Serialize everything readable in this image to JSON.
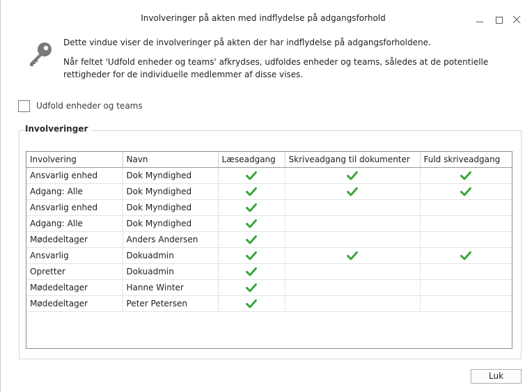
{
  "window": {
    "title": "Involveringer på akten med indflydelse på adgangsforhold"
  },
  "description": {
    "line1": "Dette vindue viser de involveringer på akten der har indflydelse på adgangsforholdene.",
    "line2": "Når feltet 'Udfold enheder og teams' afkrydses, udfoldes enheder og teams, således at de potentielle rettigheder for de individuelle medlemmer af disse vises."
  },
  "expand": {
    "label": "Udfold enheder og teams",
    "checked": false
  },
  "group": {
    "title": "Involveringer"
  },
  "table": {
    "headers": [
      "Involvering",
      "Navn",
      "Læseadgang",
      "Skriveadgang til dokumenter",
      "Fuld skriveadgang"
    ],
    "rows": [
      {
        "involvering": "Ansvarlig enhed",
        "navn": "Dok Myndighed",
        "read": true,
        "write_docs": true,
        "full_write": true
      },
      {
        "involvering": "Adgang: Alle",
        "navn": "Dok Myndighed",
        "read": true,
        "write_docs": true,
        "full_write": true
      },
      {
        "involvering": "Ansvarlig enhed",
        "navn": "Dok Myndighed",
        "read": true,
        "write_docs": false,
        "full_write": false
      },
      {
        "involvering": "Adgang: Alle",
        "navn": "Dok Myndighed",
        "read": true,
        "write_docs": false,
        "full_write": false
      },
      {
        "involvering": "Mødedeltager",
        "navn": "Anders Andersen",
        "read": true,
        "write_docs": false,
        "full_write": false
      },
      {
        "involvering": "Ansvarlig",
        "navn": "Dokuadmin",
        "read": true,
        "write_docs": true,
        "full_write": true
      },
      {
        "involvering": "Opretter",
        "navn": "Dokuadmin",
        "read": true,
        "write_docs": false,
        "full_write": false
      },
      {
        "involvering": "Mødedeltager",
        "navn": "Hanne Winter",
        "read": true,
        "write_docs": false,
        "full_write": false
      },
      {
        "involvering": "Mødedeltager",
        "navn": "Peter Petersen",
        "read": true,
        "write_docs": false,
        "full_write": false
      }
    ]
  },
  "buttons": {
    "close_label": "Luk"
  },
  "icons": {
    "key": "key-icon",
    "check": "check-icon",
    "minimize": "minimize-icon",
    "maximize": "maximize-icon",
    "close": "close-icon"
  },
  "colors": {
    "check_green": "#3aa63a",
    "key_gray": "#7a7a7a"
  }
}
